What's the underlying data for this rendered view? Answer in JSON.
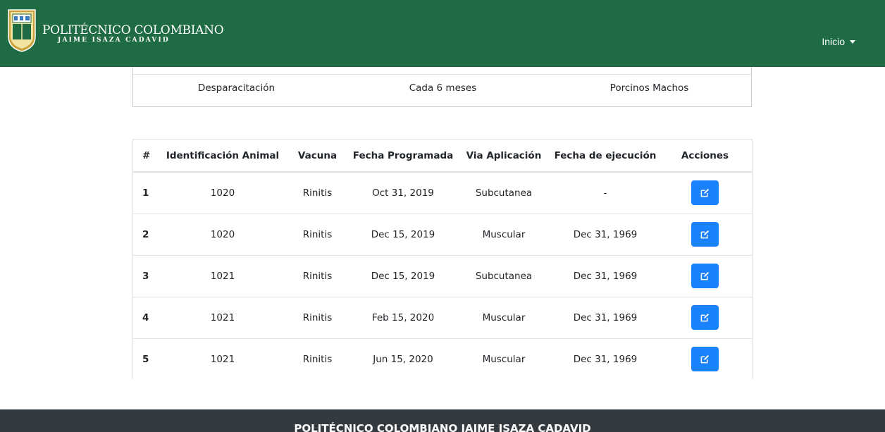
{
  "brand": {
    "title": "POLITÉCNICO COLOMBIANO",
    "subtitle": "JAIME ISAZA CADAVID"
  },
  "nav": {
    "inicio_label": "Inicio"
  },
  "summary": {
    "tratamiento": "Desparacitación",
    "frecuencia": "Cada 6 meses",
    "grupo": "Porcinos Machos"
  },
  "table": {
    "headers": [
      "#",
      "Identificación Animal",
      "Vacuna",
      "Fecha Programada",
      "Via Aplicación",
      "Fecha de ejecución",
      "Acciones"
    ],
    "rows": [
      {
        "num": "1",
        "animal": "1020",
        "vacuna": "Rinitis",
        "programada": "Oct 31, 2019",
        "via": "Subcutanea",
        "ejecucion": "-"
      },
      {
        "num": "2",
        "animal": "1020",
        "vacuna": "Rinitis",
        "programada": "Dec 15, 2019",
        "via": "Muscular",
        "ejecucion": "Dec 31, 1969"
      },
      {
        "num": "3",
        "animal": "1021",
        "vacuna": "Rinitis",
        "programada": "Dec 15, 2019",
        "via": "Subcutanea",
        "ejecucion": "Dec 31, 1969"
      },
      {
        "num": "4",
        "animal": "1021",
        "vacuna": "Rinitis",
        "programada": "Feb 15, 2020",
        "via": "Muscular",
        "ejecucion": "Dec 31, 1969"
      },
      {
        "num": "5",
        "animal": "1021",
        "vacuna": "Rinitis",
        "programada": "Jun 15, 2020",
        "via": "Muscular",
        "ejecucion": "Dec 31, 1969"
      }
    ],
    "edit_icon": "edit-icon"
  },
  "footer": {
    "text": "POLITÉCNICO COLOMBIANO JAIME ISAZA CADAVID"
  },
  "colors": {
    "navbar": "#1f6b43",
    "button": "#1a82fb",
    "footer": "#333a40"
  }
}
